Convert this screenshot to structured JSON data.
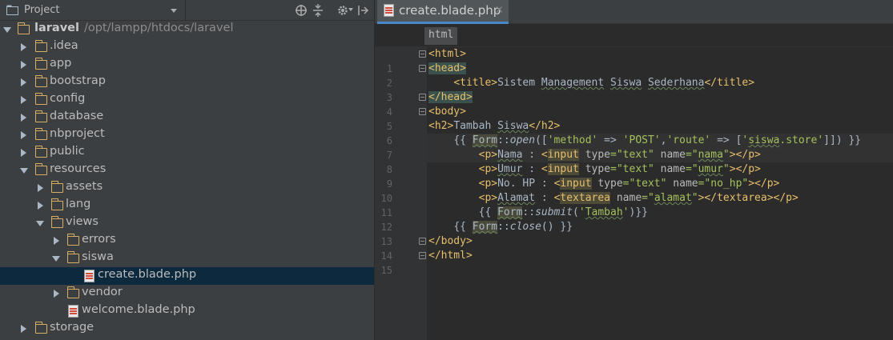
{
  "project_panel": {
    "title": "Project",
    "tree": [
      {
        "label": "laravel",
        "path": "/opt/lampp/htdocs/laravel",
        "expanded": true,
        "depth": 0,
        "kind": "folder"
      },
      {
        "label": ".idea",
        "expanded": false,
        "depth": 1,
        "kind": "folder"
      },
      {
        "label": "app",
        "expanded": false,
        "depth": 1,
        "kind": "folder"
      },
      {
        "label": "bootstrap",
        "expanded": false,
        "depth": 1,
        "kind": "folder"
      },
      {
        "label": "config",
        "expanded": false,
        "depth": 1,
        "kind": "folder"
      },
      {
        "label": "database",
        "expanded": false,
        "depth": 1,
        "kind": "folder"
      },
      {
        "label": "nbproject",
        "expanded": false,
        "depth": 1,
        "kind": "folder"
      },
      {
        "label": "public",
        "expanded": false,
        "depth": 1,
        "kind": "folder"
      },
      {
        "label": "resources",
        "expanded": true,
        "depth": 1,
        "kind": "folder"
      },
      {
        "label": "assets",
        "expanded": false,
        "depth": 2,
        "kind": "folder"
      },
      {
        "label": "lang",
        "expanded": false,
        "depth": 2,
        "kind": "folder"
      },
      {
        "label": "views",
        "expanded": true,
        "depth": 2,
        "kind": "folder"
      },
      {
        "label": "errors",
        "expanded": false,
        "depth": 3,
        "kind": "folder"
      },
      {
        "label": "siswa",
        "expanded": true,
        "depth": 3,
        "kind": "folder"
      },
      {
        "label": "create.blade.php",
        "depth": 4,
        "kind": "file",
        "selected": true
      },
      {
        "label": "vendor",
        "expanded": false,
        "depth": 3,
        "kind": "folder"
      },
      {
        "label": "welcome.blade.php",
        "depth": 3,
        "kind": "file"
      },
      {
        "label": "storage",
        "expanded": false,
        "depth": 1,
        "kind": "folder"
      }
    ]
  },
  "editor": {
    "tab_label": "create.blade.php",
    "tab_close": "×",
    "breadcrumb": "html",
    "line_numbers": [
      "1",
      "2",
      "3",
      "4",
      "5",
      "6",
      "7",
      "8",
      "9",
      "10",
      "11",
      "12",
      "13",
      "14",
      "15"
    ]
  },
  "colors": {
    "tag": "#e8bf6a",
    "string": "#a5c25c",
    "text": "#a9b7c6",
    "selection": "#0d293e",
    "folder": "#d8ae62"
  },
  "icons": [
    "project-icon",
    "target-icon",
    "collapse-icon",
    "gear-icon",
    "pin-icon",
    "folder-icon",
    "blade-file-icon",
    "fold-icon"
  ]
}
